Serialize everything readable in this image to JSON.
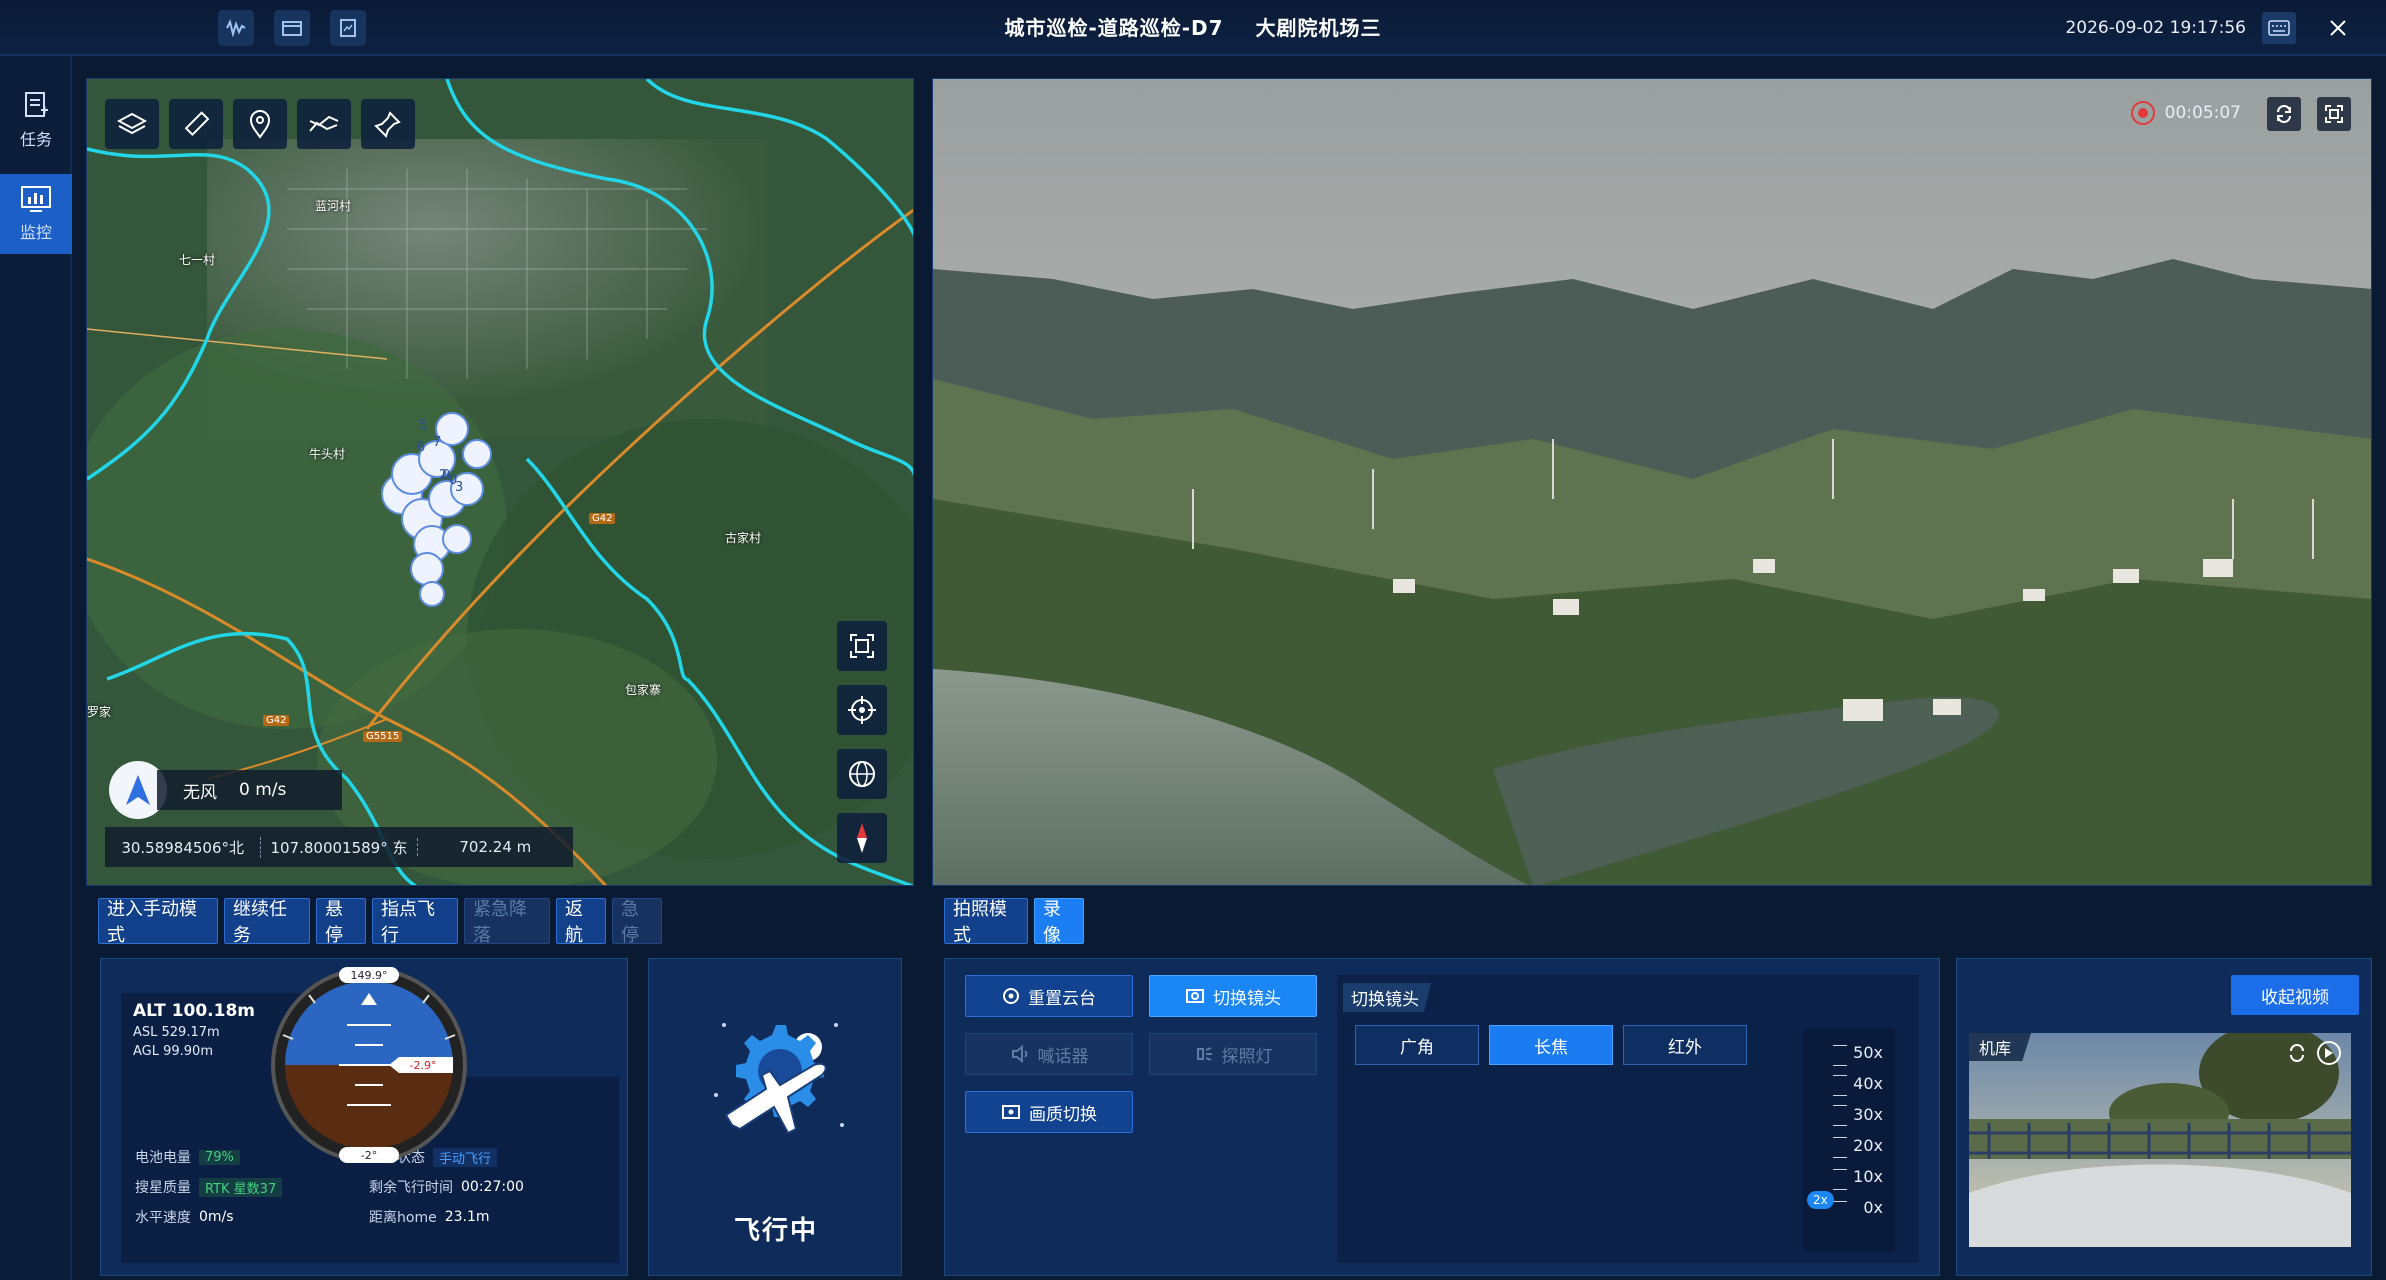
{
  "header": {
    "title_main": "城市巡检-道路巡检-D7",
    "title_site": "大剧院机场三",
    "datetime": "2026-09-02 19:17:56",
    "toolbar_icons": [
      "waveform-icon",
      "folder-icon",
      "chart-doc-icon"
    ]
  },
  "sidebar": {
    "items": [
      {
        "label": "任务",
        "icon": "task-icon",
        "active": false
      },
      {
        "label": "监控",
        "icon": "monitor-icon",
        "active": true
      }
    ]
  },
  "map": {
    "tools": [
      "layers-icon",
      "ruler-icon",
      "location-pin-icon",
      "airplane-track-icon",
      "pin-icon"
    ],
    "place_labels": [
      "蓝河村",
      "七一村",
      "牛头村",
      "古家村",
      "包家寨",
      "罗家"
    ],
    "road_labels": [
      "G42",
      "G42",
      "G5515"
    ],
    "wind": {
      "label": "无风",
      "speed": "0 m/s"
    },
    "coords": {
      "lat": "30.58984506°北",
      "lon": "107.80001589° 东",
      "alt": "702.24 m"
    },
    "controls": [
      "fit-screen-icon",
      "crosshair-icon",
      "globe-icon",
      "compass-north-icon"
    ]
  },
  "video": {
    "record_time": "00:05:07"
  },
  "flight_controls": {
    "buttons": [
      {
        "label": "进入手动模式",
        "state": "normal"
      },
      {
        "label": "继续任务",
        "state": "normal"
      },
      {
        "label": "悬停",
        "state": "normal"
      },
      {
        "label": "指点飞行",
        "state": "normal"
      },
      {
        "label": "紧急降落",
        "state": "disabled"
      },
      {
        "label": "返航",
        "state": "normal"
      },
      {
        "label": "急停",
        "state": "disabled"
      }
    ]
  },
  "camera_mode": {
    "buttons": [
      {
        "label": "拍照模式",
        "state": "normal"
      },
      {
        "label": "录像",
        "state": "selected"
      }
    ]
  },
  "telemetry": {
    "alt": "ALT  100.18m",
    "asl": "ASL   529.17m",
    "agl": "AGL   99.90m",
    "heading": "149.9°",
    "pitch": "-2.9°",
    "roll": "-2°",
    "battery_label": "电池电量",
    "battery_value": "79%",
    "flight_state_label": "飞行状态",
    "flight_state_value": "手动飞行",
    "gps_label": "搜星质量",
    "gps_value": "RTK 星数37",
    "remaining_label": "剩余飞行时间",
    "remaining_value": "00:27:00",
    "hspeed_label": "水平速度",
    "hspeed_value": "0m/s",
    "home_label": "距离home",
    "home_value": "23.1m"
  },
  "status": {
    "label": "飞行中"
  },
  "gimbal": {
    "reset": "重置云台",
    "switch_lens": "切换镜头",
    "speaker": "喊话器",
    "spotlight": "探照灯",
    "quality": "画质切换",
    "lens_title": "切换镜头",
    "lenses": [
      {
        "label": "广角",
        "selected": false
      },
      {
        "label": "长焦",
        "selected": true
      },
      {
        "label": "红外",
        "selected": false
      }
    ],
    "zoom_ticks": [
      "50x",
      "40x",
      "30x",
      "20x",
      "10x",
      "0x"
    ],
    "zoom_current": "2x"
  },
  "dock": {
    "collapse": "收起视频",
    "label": "机库"
  },
  "colors": {
    "accent": "#1b7ef5",
    "panel": "#0d2550",
    "ok": "#44d27a",
    "record": "#e13a3a"
  }
}
